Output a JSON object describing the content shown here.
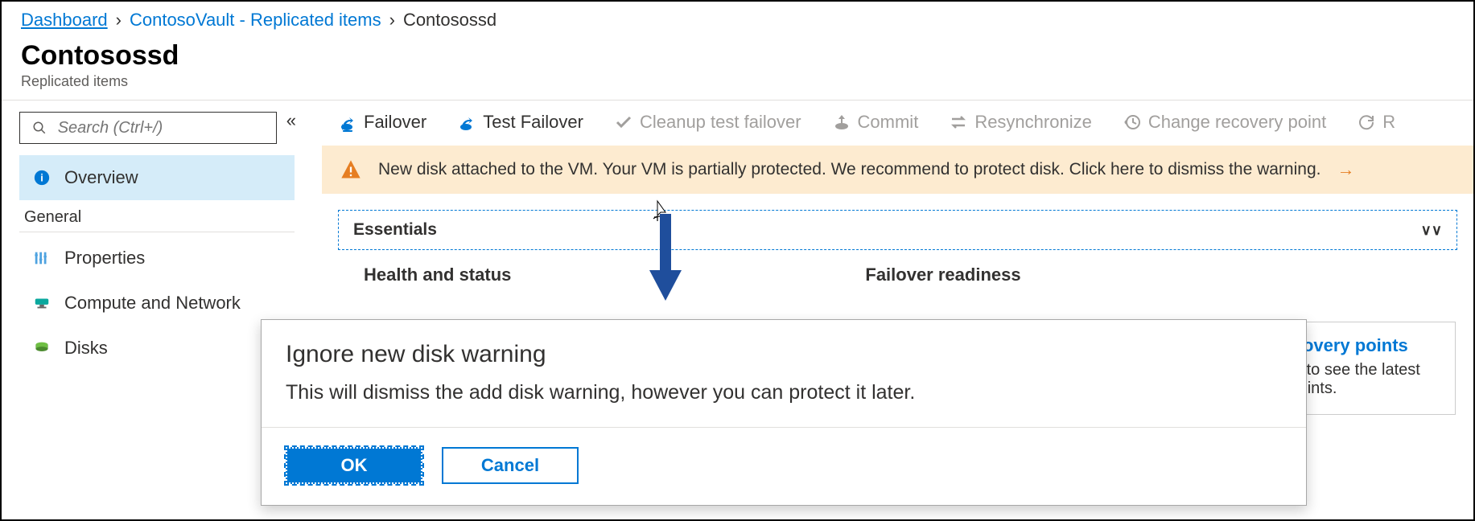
{
  "breadcrumb": {
    "dashboard": "Dashboard",
    "vault": "ContosoVault - Replicated items",
    "current": "Contosossd"
  },
  "header": {
    "title": "Contosossd",
    "subtitle": "Replicated items"
  },
  "sidebar": {
    "search_placeholder": "Search (Ctrl+/)",
    "overview": "Overview",
    "general_label": "General",
    "items": [
      {
        "label": "Properties"
      },
      {
        "label": "Compute and Network"
      },
      {
        "label": "Disks"
      }
    ]
  },
  "toolbar": {
    "failover": "Failover",
    "test_failover": "Test Failover",
    "cleanup": "Cleanup test failover",
    "commit": "Commit",
    "resync": "Resynchronize",
    "change_recovery": "Change recovery point",
    "reprotect": "R"
  },
  "banner": {
    "text": "New disk attached to the VM. Your VM is partially protected. We recommend to protect disk. Click here to dismiss the warning."
  },
  "essentials": {
    "label": "Essentials"
  },
  "panels": {
    "health": "Health and status",
    "failover_readiness": "Failover readiness"
  },
  "recovery_card": {
    "title": "est recovery points",
    "desc_line1": "k above to see the latest",
    "desc_line2": "overy points."
  },
  "dialog": {
    "title": "Ignore new disk warning",
    "body": "This will dismiss the add disk warning, however you can protect it later.",
    "ok": "OK",
    "cancel": "Cancel"
  }
}
